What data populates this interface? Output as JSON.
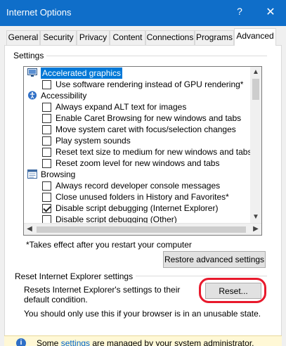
{
  "window": {
    "title": "Internet Options",
    "help_glyph": "?",
    "close_glyph": "✕"
  },
  "tabs": [
    {
      "label": "General"
    },
    {
      "label": "Security"
    },
    {
      "label": "Privacy"
    },
    {
      "label": "Content"
    },
    {
      "label": "Connections"
    },
    {
      "label": "Programs"
    },
    {
      "label": "Advanced",
      "selected": true
    }
  ],
  "settings": {
    "group_label": "Settings",
    "items": [
      {
        "type": "category",
        "icon": "monitor-icon",
        "label": "Accelerated graphics",
        "selected": true
      },
      {
        "type": "checkbox",
        "label": "Use software rendering instead of GPU rendering*",
        "checked": false
      },
      {
        "type": "category",
        "icon": "accessibility-icon",
        "label": "Accessibility"
      },
      {
        "type": "checkbox",
        "label": "Always expand ALT text for images",
        "checked": false
      },
      {
        "type": "checkbox",
        "label": "Enable Caret Browsing for new windows and tabs",
        "checked": false
      },
      {
        "type": "checkbox",
        "label": "Move system caret with focus/selection changes",
        "checked": false
      },
      {
        "type": "checkbox",
        "label": "Play system sounds",
        "checked": false
      },
      {
        "type": "checkbox",
        "label": "Reset text size to medium for new windows and tabs",
        "checked": false
      },
      {
        "type": "checkbox",
        "label": "Reset zoom level for new windows and tabs",
        "checked": false
      },
      {
        "type": "category",
        "icon": "browser-window-icon",
        "label": "Browsing"
      },
      {
        "type": "checkbox",
        "label": "Always record developer console messages",
        "checked": false
      },
      {
        "type": "checkbox",
        "label": "Close unused folders in History and Favorites*",
        "checked": false
      },
      {
        "type": "checkbox",
        "label": "Disable script debugging (Internet Explorer)",
        "checked": true
      },
      {
        "type": "checkbox",
        "label": "Disable script debugging (Other)",
        "checked": false
      }
    ],
    "restart_note": "*Takes effect after you restart your computer",
    "restore_button": "Restore advanced settings"
  },
  "reset": {
    "group_label": "Reset Internet Explorer settings",
    "description": "Resets Internet Explorer's settings to their default condition.",
    "reset_button": "Reset...",
    "warning": "You should only use this if your browser is in an unusable state."
  },
  "infobar": {
    "icon": "info-icon",
    "prefix": "Some ",
    "link": "settings",
    "suffix": " are managed by your system administrator."
  },
  "colors": {
    "titlebar": "#0f6ec9",
    "selection": "#0078d7",
    "annotation": "#e8192c"
  }
}
